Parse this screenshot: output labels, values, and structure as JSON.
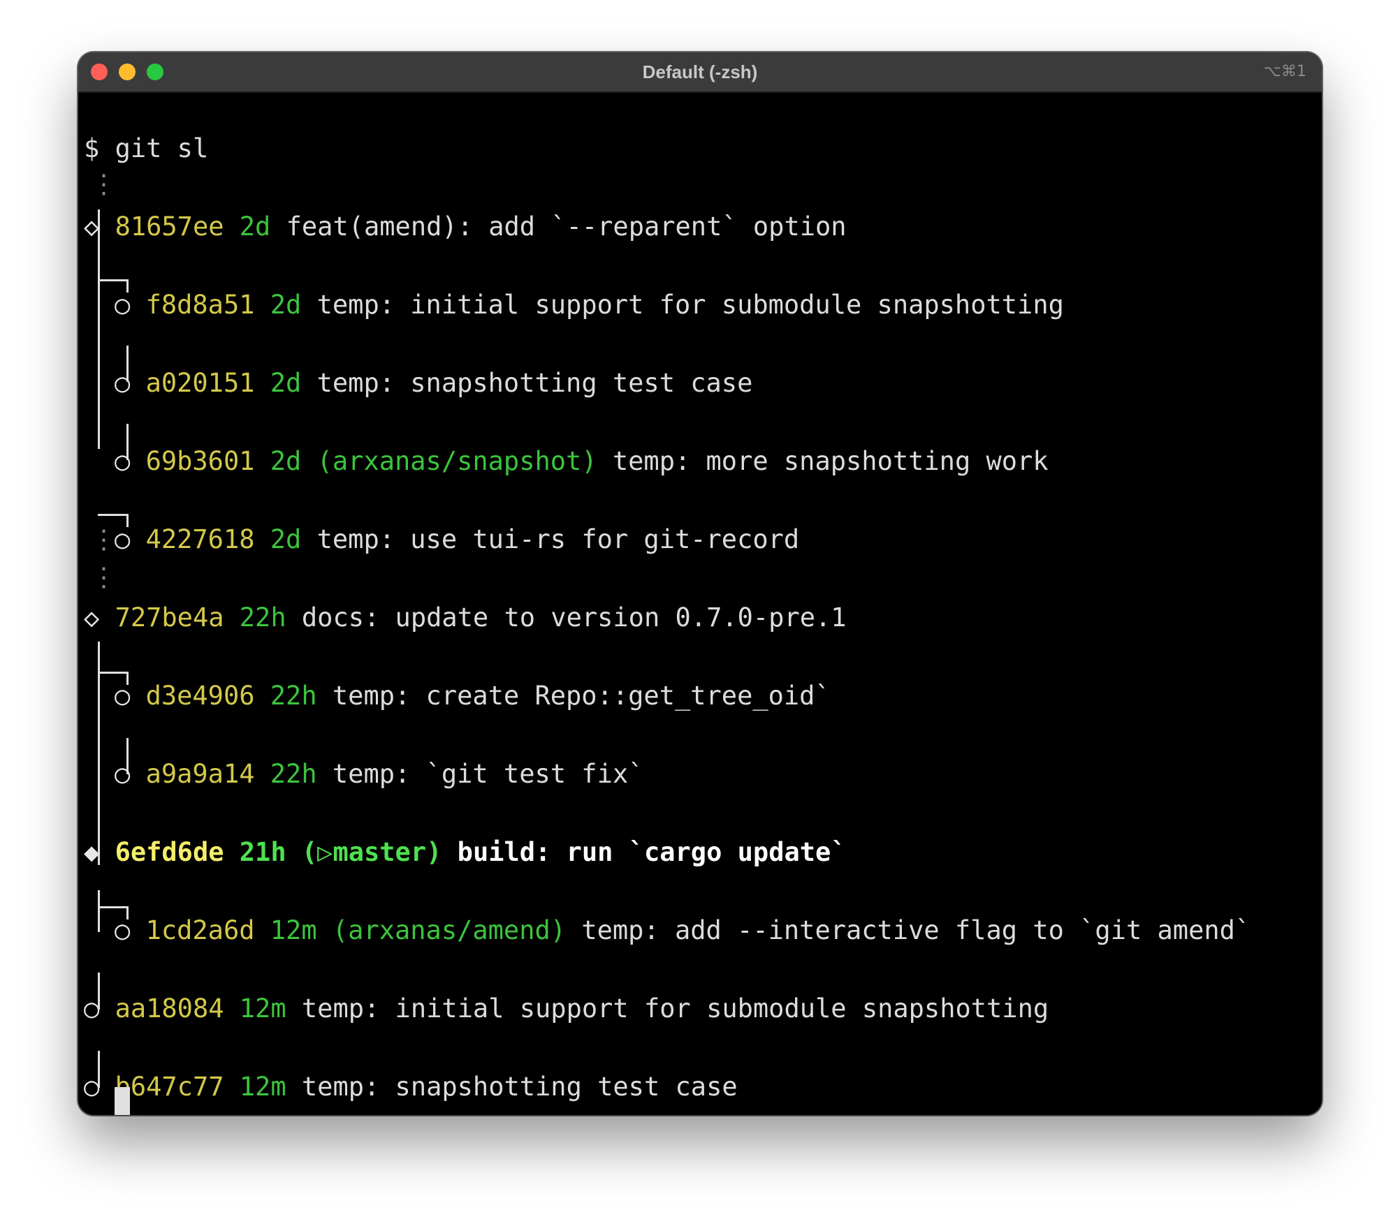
{
  "window": {
    "title": "Default (-zsh)",
    "shortcut": "⌥⌘1"
  },
  "terminal": {
    "prompt": "$",
    "command": "git sl",
    "ellipsis": "⋮",
    "commits": [
      {
        "hash": "81657ee",
        "age": "2d",
        "branch": "",
        "message": "feat(amend): add `--reparent` option",
        "symbol": "◇"
      },
      {
        "hash": "f8d8a51",
        "age": "2d",
        "branch": "",
        "message": "temp: initial support for submodule snapshotting",
        "symbol": "○"
      },
      {
        "hash": "a020151",
        "age": "2d",
        "branch": "",
        "message": "temp: snapshotting test case",
        "symbol": "○"
      },
      {
        "hash": "69b3601",
        "age": "2d",
        "branch": "(arxanas/snapshot)",
        "message": "temp: more snapshotting work",
        "symbol": "○"
      },
      {
        "hash": "4227618",
        "age": "2d",
        "branch": "",
        "message": "temp: use tui-rs for git-record",
        "symbol": "○"
      },
      {
        "hash": "727be4a",
        "age": "22h",
        "branch": "",
        "message": "docs: update to version 0.7.0-pre.1",
        "symbol": "◇"
      },
      {
        "hash": "d3e4906",
        "age": "22h",
        "branch": "",
        "message": "temp: create Repo::get_tree_oid`",
        "symbol": "○"
      },
      {
        "hash": "a9a9a14",
        "age": "22h",
        "branch": "",
        "message": "temp: `git test fix`",
        "symbol": "○"
      },
      {
        "hash": "6efd6de",
        "age": "21h",
        "branch_open": "(",
        "branch_marker": "▷",
        "branch_name": "master)",
        "message": "build: run `cargo update`",
        "symbol": "◆"
      },
      {
        "hash": "1cd2a6d",
        "age": "12m",
        "branch": "(arxanas/amend)",
        "message": "temp: add --interactive flag to `git amend`",
        "symbol": "○"
      },
      {
        "hash": "aa18084",
        "age": "12m",
        "branch": "",
        "message": "temp: initial support for submodule snapshotting",
        "symbol": "○"
      },
      {
        "hash": "b647c77",
        "age": "12m",
        "branch": "",
        "message": "temp: snapshotting test case",
        "symbol": "○"
      }
    ]
  },
  "colors": {
    "hash": "#d4c94a",
    "age": "#3cc43c",
    "background": "#000000"
  }
}
